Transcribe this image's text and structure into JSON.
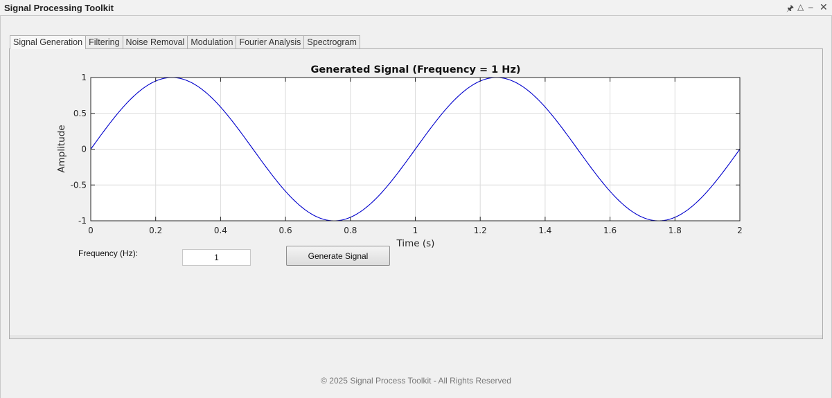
{
  "window": {
    "title": "Signal Processing Toolkit",
    "controls": [
      "pin-icon",
      "undock-icon",
      "minimize-icon",
      "close-icon"
    ]
  },
  "tabs": [
    {
      "label": "Signal Generation",
      "active": true
    },
    {
      "label": "Filtering",
      "active": false
    },
    {
      "label": "Noise Removal",
      "active": false
    },
    {
      "label": "Modulation",
      "active": false
    },
    {
      "label": "Fourier Analysis",
      "active": false
    },
    {
      "label": "Spectrogram",
      "active": false
    }
  ],
  "controls": {
    "frequency_label": "Frequency (Hz):",
    "frequency_value": "1",
    "generate_label": "Generate Signal"
  },
  "footer": "© 2025 Signal Process Toolkit - All Rights Reserved",
  "chart_data": {
    "type": "line",
    "title": "Generated Signal (Frequency = 1 Hz)",
    "xlabel": "Time (s)",
    "ylabel": "Amplitude",
    "xlim": [
      0,
      2
    ],
    "ylim": [
      -1,
      1
    ],
    "xticks": [
      0,
      0.2,
      0.4,
      0.6,
      0.8,
      1,
      1.2,
      1.4,
      1.6,
      1.8,
      2
    ],
    "xtick_labels": [
      "0",
      "0.2",
      "0.4",
      "0.6",
      "0.8",
      "1",
      "1.2",
      "1.4",
      "1.6",
      "1.8",
      "2"
    ],
    "yticks": [
      -1,
      -0.5,
      0,
      0.5,
      1
    ],
    "ytick_labels": [
      "-1",
      "-0.5",
      "0",
      "0.5",
      "1"
    ],
    "grid": true,
    "series": [
      {
        "function": "sin(2*pi*1*t)",
        "color": "#0000cc",
        "x": [
          0,
          0.05,
          0.1,
          0.15,
          0.2,
          0.25,
          0.3,
          0.35,
          0.4,
          0.45,
          0.5,
          0.55,
          0.6,
          0.65,
          0.7,
          0.75,
          0.8,
          0.85,
          0.9,
          0.95,
          1,
          1.05,
          1.1,
          1.15,
          1.2,
          1.25,
          1.3,
          1.35,
          1.4,
          1.45,
          1.5,
          1.55,
          1.6,
          1.65,
          1.7,
          1.75,
          1.8,
          1.85,
          1.9,
          1.95,
          2
        ],
        "y": [
          0,
          0.309,
          0.588,
          0.809,
          0.951,
          1,
          0.951,
          0.809,
          0.588,
          0.309,
          0,
          -0.309,
          -0.588,
          -0.809,
          -0.951,
          -1,
          -0.951,
          -0.809,
          -0.588,
          -0.309,
          0,
          0.309,
          0.588,
          0.809,
          0.951,
          1,
          0.951,
          0.809,
          0.588,
          0.309,
          0,
          -0.309,
          -0.588,
          -0.809,
          -0.951,
          -1,
          -0.951,
          -0.809,
          -0.588,
          -0.309,
          0
        ]
      }
    ]
  }
}
